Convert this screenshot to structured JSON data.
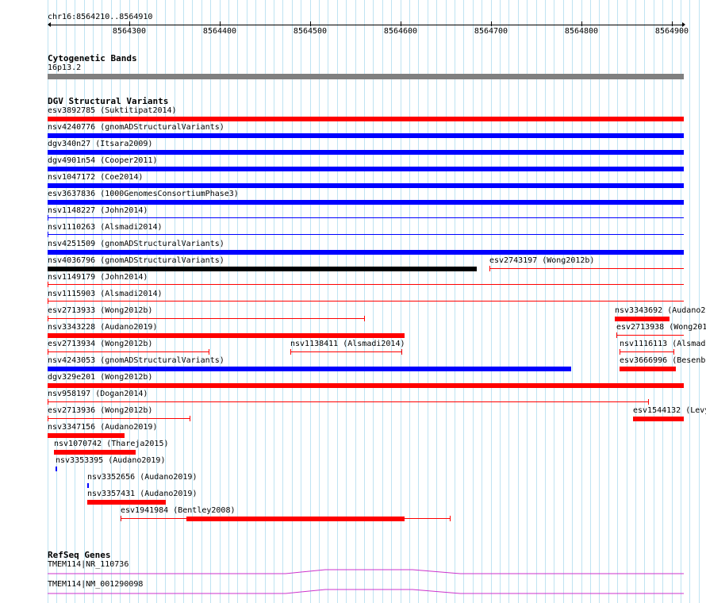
{
  "ruler": {
    "coordinate": "chr16:8564210..8564910",
    "ticks": [
      "8564300",
      "8564400",
      "8564500",
      "8564600",
      "8564700",
      "8564800",
      "8564900"
    ]
  },
  "tracks": {
    "cytoband": {
      "title": "Cytogenetic Bands",
      "band": "16p13.2"
    },
    "dgv": {
      "title": "DGV Structural Variants",
      "rows": [
        {
          "label": "esv3892785 (Suktitipat2014)",
          "color": "#ff0000"
        },
        {
          "label": "nsv4240776 (gnomADStructuralVariants)",
          "color": "#0000ff"
        },
        {
          "label": "dgv340n27 (Itsara2009)",
          "color": "#0000ff"
        },
        {
          "label": "dgv4901n54 (Cooper2011)",
          "color": "#0000ff"
        },
        {
          "label": "nsv1047172 (Coe2014)",
          "color": "#0000ff"
        },
        {
          "label": "esv3637836 (1000GenomesConsortiumPhase3)",
          "color": "#0000ff"
        },
        {
          "label": "nsv1148227 (John2014)",
          "color": "#0000ff"
        },
        {
          "label": "nsv1110263 (Alsmadi2014)",
          "color": "#0000ff"
        },
        {
          "label": "nsv4251509 (gnomADStructuralVariants)",
          "color": "#0000ff"
        },
        {
          "label": "nsv4036796 (gnomADStructuralVariants)",
          "color": "#000000"
        },
        {
          "label": "esv2743197 (Wong2012b)",
          "color": "#ff0000"
        },
        {
          "label": "nsv1149179 (John2014)",
          "color": "#ff0000"
        },
        {
          "label": "nsv1115903 (Alsmadi2014)",
          "color": "#ff0000"
        },
        {
          "label": "esv2713933 (Wong2012b)",
          "color": "#ff0000"
        },
        {
          "label": "nsv3343692 (Audano20",
          "color": "#ff0000"
        },
        {
          "label": "nsv3343228 (Audano2019)",
          "color": "#ff0000"
        },
        {
          "label": "esv2713938 (Wong201",
          "color": "#ff0000"
        },
        {
          "label": "esv2713934 (Wong2012b)",
          "color": "#ff0000"
        },
        {
          "label": "nsv1138411 (Alsmadi2014)",
          "color": "#ff0000"
        },
        {
          "label": "nsv1116113 (Alsmadi",
          "color": "#ff0000"
        },
        {
          "label": "nsv4243053 (gnomADStructuralVariants)",
          "color": "#0000ff"
        },
        {
          "label": "esv3666996 (Besenba",
          "color": "#ff0000"
        },
        {
          "label": "dgv329e201 (Wong2012b)",
          "color": "#ff0000"
        },
        {
          "label": "nsv958197 (Dogan2014)",
          "color": "#ff0000"
        },
        {
          "label": "esv2713936 (Wong2012b)",
          "color": "#ff0000"
        },
        {
          "label": "esv1544132 (Levy",
          "color": "#ff0000"
        },
        {
          "label": "nsv3347156 (Audano2019)",
          "color": "#ff0000"
        },
        {
          "label": "nsv1070742 (Thareja2015)",
          "color": "#ff0000"
        },
        {
          "label": "nsv3353395 (Audano2019)",
          "color": "#0000ff"
        },
        {
          "label": "nsv3352656 (Audano2019)",
          "color": "#0000ff"
        },
        {
          "label": "nsv3357431 (Audano2019)",
          "color": "#ff0000"
        },
        {
          "label": "esv1941984 (Bentley2008)",
          "color": "#ff0000"
        }
      ]
    },
    "refseq": {
      "title": "RefSeq Genes",
      "genes": [
        {
          "label": "TMEM114|NR_110736",
          "color": "#cc33cc"
        },
        {
          "label": "TMEM114|NM_001290098",
          "color": "#cc33cc"
        }
      ]
    }
  }
}
